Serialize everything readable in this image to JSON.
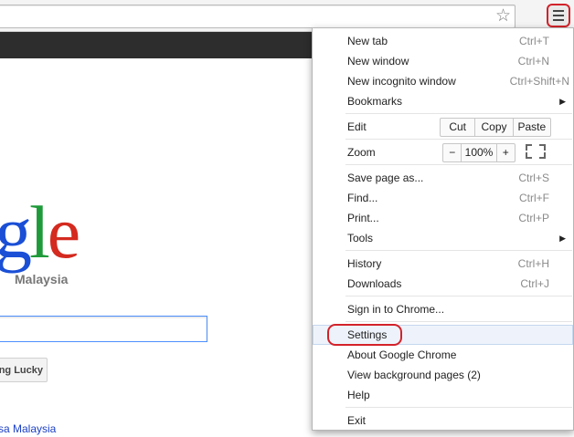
{
  "toolbar": {
    "star_icon": "star-icon",
    "menu_icon": "hamburger-menu-icon"
  },
  "page": {
    "logo": {
      "g": "g",
      "l": "l",
      "e": "e"
    },
    "logo_sub": "Malaysia",
    "lucky_label": "ng Lucky",
    "bottom_link": "sa Malaysia"
  },
  "menu": {
    "items": [
      {
        "label": "New tab",
        "shortcut": "Ctrl+T"
      },
      {
        "label": "New window",
        "shortcut": "Ctrl+N"
      },
      {
        "label": "New incognito window",
        "shortcut": "Ctrl+Shift+N"
      },
      {
        "label": "Bookmarks",
        "shortcut": ""
      },
      {
        "label": "Edit",
        "shortcut": ""
      },
      {
        "label": "Zoom",
        "shortcut": ""
      },
      {
        "label": "Save page as...",
        "shortcut": "Ctrl+S"
      },
      {
        "label": "Find...",
        "shortcut": "Ctrl+F"
      },
      {
        "label": "Print...",
        "shortcut": "Ctrl+P"
      },
      {
        "label": "Tools",
        "shortcut": ""
      },
      {
        "label": "History",
        "shortcut": "Ctrl+H"
      },
      {
        "label": "Downloads",
        "shortcut": "Ctrl+J"
      },
      {
        "label": "Sign in to Chrome...",
        "shortcut": ""
      },
      {
        "label": "Settings",
        "shortcut": ""
      },
      {
        "label": "About Google Chrome",
        "shortcut": ""
      },
      {
        "label": "View background pages (2)",
        "shortcut": ""
      },
      {
        "label": "Help",
        "shortcut": ""
      },
      {
        "label": "Exit",
        "shortcut": ""
      }
    ],
    "edit": {
      "cut": "Cut",
      "copy": "Copy",
      "paste": "Paste"
    },
    "zoom": {
      "minus": "−",
      "level": "100%",
      "plus": "+",
      "fullscreen_icon": "fullscreen-icon"
    }
  },
  "colors": {
    "highlight_ring": "#d3222a",
    "logo_blue": "#1a4fd6",
    "logo_green": "#1f9a3a",
    "logo_red": "#d42a1f"
  }
}
